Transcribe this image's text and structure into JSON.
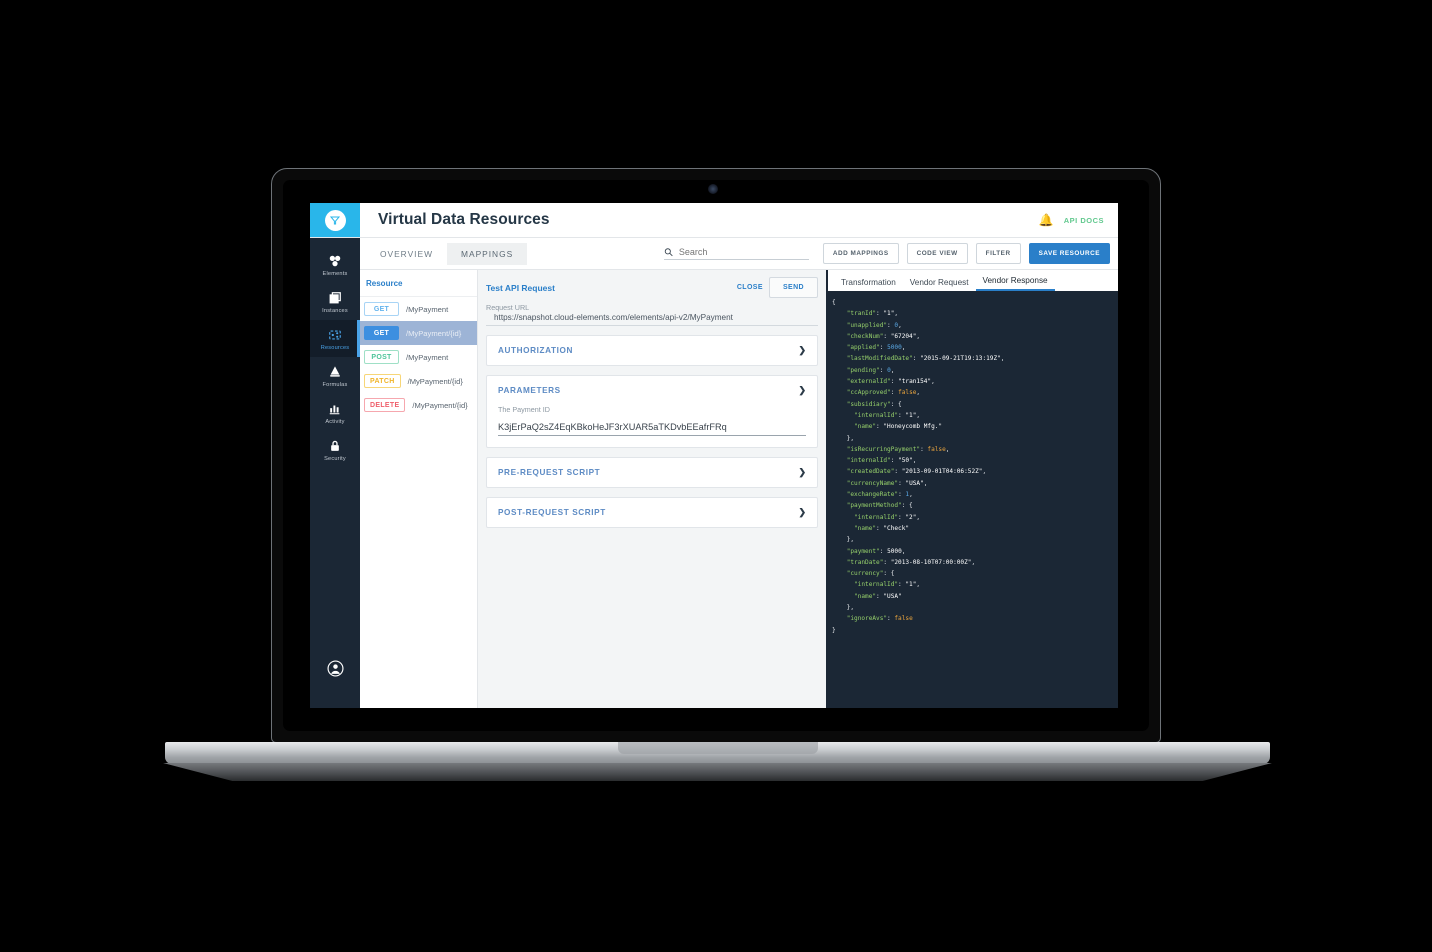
{
  "header": {
    "app_title": "Virtual Data Resources",
    "bell_icon": "bell-icon",
    "api_docs_label": "API DOCS",
    "logo_icon": "funnel-logo-icon",
    "brand_color": "#29b6ea"
  },
  "sidebar": {
    "items": [
      {
        "label": "Elements",
        "icon": "elements-icon",
        "active": false
      },
      {
        "label": "Instances",
        "icon": "instances-icon",
        "active": false
      },
      {
        "label": "Resources",
        "icon": "resources-icon",
        "active": true
      },
      {
        "label": "Formulas",
        "icon": "formulas-icon",
        "active": false
      },
      {
        "label": "Activity",
        "icon": "activity-icon",
        "active": false
      },
      {
        "label": "Security",
        "icon": "security-icon",
        "active": false
      }
    ],
    "avatar_icon": "user-avatar-icon"
  },
  "toolbar": {
    "tabs": [
      {
        "label": "OVERVIEW",
        "active": false
      },
      {
        "label": "MAPPINGS",
        "active": true
      }
    ],
    "search": {
      "placeholder": "Search",
      "value": "",
      "icon": "search-icon"
    },
    "buttons": [
      {
        "label": "ADD MAPPINGS",
        "primary": false
      },
      {
        "label": "CODE VIEW",
        "primary": false
      },
      {
        "label": "FILTER",
        "primary": false
      },
      {
        "label": "SAVE RESOURCE",
        "primary": true
      }
    ]
  },
  "resources": {
    "header": "Resource",
    "rows": [
      {
        "method": "GET",
        "path": "/MyPayment",
        "style": "m-get",
        "selected": false
      },
      {
        "method": "GET",
        "path": "/MyPayment/{id}",
        "style": "m-get-sel",
        "selected": true
      },
      {
        "method": "POST",
        "path": "/MyPayment",
        "style": "m-post",
        "selected": false
      },
      {
        "method": "PATCH",
        "path": "/MyPayment/{id}",
        "style": "m-patch",
        "selected": false
      },
      {
        "method": "DELETE",
        "path": "/MyPayment/{id}",
        "style": "m-del",
        "selected": false
      }
    ]
  },
  "request": {
    "title": "Test API Request",
    "close_label": "CLOSE",
    "send_label": "SEND",
    "url_label": "Request URL",
    "url_value": "https://snapshot.cloud-elements.com/elements/api-v2/MyPayment",
    "sections": [
      {
        "title": "AUTHORIZATION",
        "expanded": false
      },
      {
        "title": "PARAMETERS",
        "expanded": true
      },
      {
        "title": "PRE-REQUEST SCRIPT",
        "expanded": false
      },
      {
        "title": "POST-REQUEST SCRIPT",
        "expanded": false
      }
    ],
    "parameter": {
      "label": "The Payment ID",
      "value": "K3jErPaQ2sZ4EqKBkoHeJF3rXUAR5aTKDvbEEafrFRq"
    }
  },
  "response": {
    "tabs": [
      {
        "label": "Transformation",
        "active": false
      },
      {
        "label": "Vendor Request",
        "active": false
      },
      {
        "label": "Vendor Response",
        "active": true
      }
    ],
    "json_lines": [
      [
        {
          "t": "{",
          "c": "jp"
        }
      ],
      [
        {
          "t": "    ",
          "c": "jp"
        },
        {
          "t": "\"tranId\"",
          "c": "jk"
        },
        {
          "t": ": ",
          "c": "jp"
        },
        {
          "t": "\"1\"",
          "c": "js"
        },
        {
          "t": ",",
          "c": "jp"
        }
      ],
      [
        {
          "t": "    ",
          "c": "jp"
        },
        {
          "t": "\"unapplied\"",
          "c": "jk"
        },
        {
          "t": ": ",
          "c": "jp"
        },
        {
          "t": "0",
          "c": "jn"
        },
        {
          "t": ",",
          "c": "jp"
        }
      ],
      [
        {
          "t": "    ",
          "c": "jp"
        },
        {
          "t": "\"checkNum\"",
          "c": "jk"
        },
        {
          "t": ": ",
          "c": "jp"
        },
        {
          "t": "\"67204\"",
          "c": "js"
        },
        {
          "t": ",",
          "c": "jp"
        }
      ],
      [
        {
          "t": "    ",
          "c": "jp"
        },
        {
          "t": "\"applied\"",
          "c": "jk"
        },
        {
          "t": ": ",
          "c": "jp"
        },
        {
          "t": "5000",
          "c": "jn"
        },
        {
          "t": ",",
          "c": "jp"
        }
      ],
      [
        {
          "t": "    ",
          "c": "jp"
        },
        {
          "t": "\"lastModifiedDate\"",
          "c": "jk"
        },
        {
          "t": ": ",
          "c": "jp"
        },
        {
          "t": "\"2015-09-21T19:13:19Z\"",
          "c": "js"
        },
        {
          "t": ",",
          "c": "jp"
        }
      ],
      [
        {
          "t": "    ",
          "c": "jp"
        },
        {
          "t": "\"pending\"",
          "c": "jk"
        },
        {
          "t": ": ",
          "c": "jp"
        },
        {
          "t": "0",
          "c": "jn"
        },
        {
          "t": ",",
          "c": "jp"
        }
      ],
      [
        {
          "t": "    ",
          "c": "jp"
        },
        {
          "t": "\"externalId\"",
          "c": "jk"
        },
        {
          "t": ": ",
          "c": "jp"
        },
        {
          "t": "\"tran154\"",
          "c": "js"
        },
        {
          "t": ",",
          "c": "jp"
        }
      ],
      [
        {
          "t": "    ",
          "c": "jp"
        },
        {
          "t": "\"ccApproved\"",
          "c": "jk"
        },
        {
          "t": ": ",
          "c": "jp"
        },
        {
          "t": "false",
          "c": "jb"
        },
        {
          "t": ",",
          "c": "jp"
        }
      ],
      [
        {
          "t": "    ",
          "c": "jp"
        },
        {
          "t": "\"subsidiary\"",
          "c": "jk"
        },
        {
          "t": ": {",
          "c": "jp"
        }
      ],
      [
        {
          "t": "      ",
          "c": "jp"
        },
        {
          "t": "\"internalId\"",
          "c": "jk"
        },
        {
          "t": ": ",
          "c": "jp"
        },
        {
          "t": "\"1\"",
          "c": "js"
        },
        {
          "t": ",",
          "c": "jp"
        }
      ],
      [
        {
          "t": "      ",
          "c": "jp"
        },
        {
          "t": "\"name\"",
          "c": "jk"
        },
        {
          "t": ": ",
          "c": "jp"
        },
        {
          "t": "\"Honeycomb Mfg.\"",
          "c": "js"
        }
      ],
      [
        {
          "t": "    },",
          "c": "jp"
        }
      ],
      [
        {
          "t": "    ",
          "c": "jp"
        },
        {
          "t": "\"isRecurringPayment\"",
          "c": "jk"
        },
        {
          "t": ": ",
          "c": "jp"
        },
        {
          "t": "false",
          "c": "jb"
        },
        {
          "t": ",",
          "c": "jp"
        }
      ],
      [
        {
          "t": "    ",
          "c": "jp"
        },
        {
          "t": "\"internalId\"",
          "c": "jk"
        },
        {
          "t": ": ",
          "c": "jp"
        },
        {
          "t": "\"50\"",
          "c": "js"
        },
        {
          "t": ",",
          "c": "jp"
        }
      ],
      [
        {
          "t": "    ",
          "c": "jp"
        },
        {
          "t": "\"createdDate\"",
          "c": "jk"
        },
        {
          "t": ": ",
          "c": "jp"
        },
        {
          "t": "\"2013-09-01T04:06:52Z\"",
          "c": "js"
        },
        {
          "t": ",",
          "c": "jp"
        }
      ],
      [
        {
          "t": "    ",
          "c": "jp"
        },
        {
          "t": "\"currencyName\"",
          "c": "jk"
        },
        {
          "t": ": ",
          "c": "jp"
        },
        {
          "t": "\"USA\"",
          "c": "js"
        },
        {
          "t": ",",
          "c": "jp"
        }
      ],
      [
        {
          "t": "    ",
          "c": "jp"
        },
        {
          "t": "\"exchangeRate\"",
          "c": "jk"
        },
        {
          "t": ": ",
          "c": "jp"
        },
        {
          "t": "1",
          "c": "jn"
        },
        {
          "t": ",",
          "c": "jp"
        }
      ],
      [
        {
          "t": "    ",
          "c": "jp"
        },
        {
          "t": "\"paymentMethod\"",
          "c": "jk"
        },
        {
          "t": ": {",
          "c": "jp"
        }
      ],
      [
        {
          "t": "      ",
          "c": "jp"
        },
        {
          "t": "\"internalId\"",
          "c": "jk"
        },
        {
          "t": ": ",
          "c": "jp"
        },
        {
          "t": "\"2\"",
          "c": "js"
        },
        {
          "t": ",",
          "c": "jp"
        }
      ],
      [
        {
          "t": "      ",
          "c": "jp"
        },
        {
          "t": "\"name\"",
          "c": "jk"
        },
        {
          "t": ": ",
          "c": "jp"
        },
        {
          "t": "\"Check\"",
          "c": "js"
        }
      ],
      [
        {
          "t": "    },",
          "c": "jp"
        }
      ],
      [
        {
          "t": "    ",
          "c": "jp"
        },
        {
          "t": "\"payment\"",
          "c": "jk"
        },
        {
          "t": ": ",
          "c": "jp"
        },
        {
          "t": "5000",
          "c": "js"
        },
        {
          "t": ",",
          "c": "jp"
        }
      ],
      [
        {
          "t": "    ",
          "c": "jp"
        },
        {
          "t": "\"tranDate\"",
          "c": "jk"
        },
        {
          "t": ": ",
          "c": "jp"
        },
        {
          "t": "\"2013-08-10T07:00:00Z\"",
          "c": "js"
        },
        {
          "t": ",",
          "c": "jp"
        }
      ],
      [
        {
          "t": "    ",
          "c": "jp"
        },
        {
          "t": "\"currency\"",
          "c": "jk"
        },
        {
          "t": ": {",
          "c": "jp"
        }
      ],
      [
        {
          "t": "      ",
          "c": "jp"
        },
        {
          "t": "\"internalId\"",
          "c": "jk"
        },
        {
          "t": ": ",
          "c": "jp"
        },
        {
          "t": "\"1\"",
          "c": "js"
        },
        {
          "t": ",",
          "c": "jp"
        }
      ],
      [
        {
          "t": "      ",
          "c": "jp"
        },
        {
          "t": "\"name\"",
          "c": "jk"
        },
        {
          "t": ": ",
          "c": "jp"
        },
        {
          "t": "\"USA\"",
          "c": "js"
        }
      ],
      [
        {
          "t": "    },",
          "c": "jp"
        }
      ],
      [
        {
          "t": "    ",
          "c": "jp"
        },
        {
          "t": "\"ignoreAvs\"",
          "c": "jk"
        },
        {
          "t": ": ",
          "c": "jp"
        },
        {
          "t": "false",
          "c": "jb"
        }
      ],
      [
        {
          "t": "}",
          "c": "jp"
        }
      ]
    ]
  }
}
